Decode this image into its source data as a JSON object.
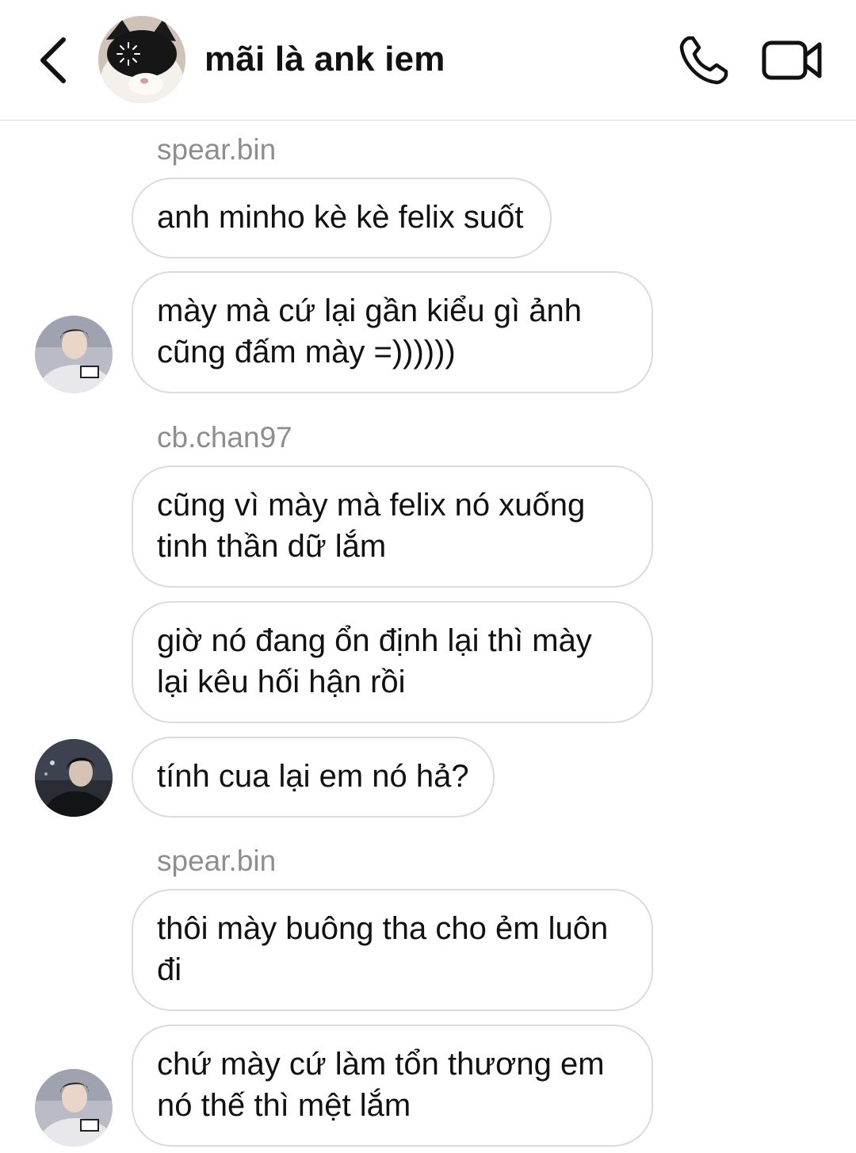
{
  "header": {
    "title": "mãi là ank iem",
    "back_icon": "chevron-left-icon",
    "call_icon": "phone-icon",
    "video_icon": "video-camera-icon"
  },
  "messages": [
    {
      "sender": "spear.bin"
    },
    {
      "text": "anh minho kè kè felix suốt"
    },
    {
      "text": "mày mà cứ lại gần kiểu gì ảnh cũng đấm mày =))))))"
    },
    {
      "sender": "cb.chan97"
    },
    {
      "text": "cũng vì mày mà felix nó xuống tinh thần dữ lắm"
    },
    {
      "text": "giờ nó đang ổn định lại thì mày lại kêu hối hận rồi"
    },
    {
      "text": "tính cua lại em nó hả?"
    },
    {
      "sender": "spear.bin"
    },
    {
      "text": "thôi mày buông tha cho ẻm luôn đi"
    },
    {
      "text": "chứ mày cứ làm tổn thương em nó thế thì mệt lắm"
    }
  ]
}
